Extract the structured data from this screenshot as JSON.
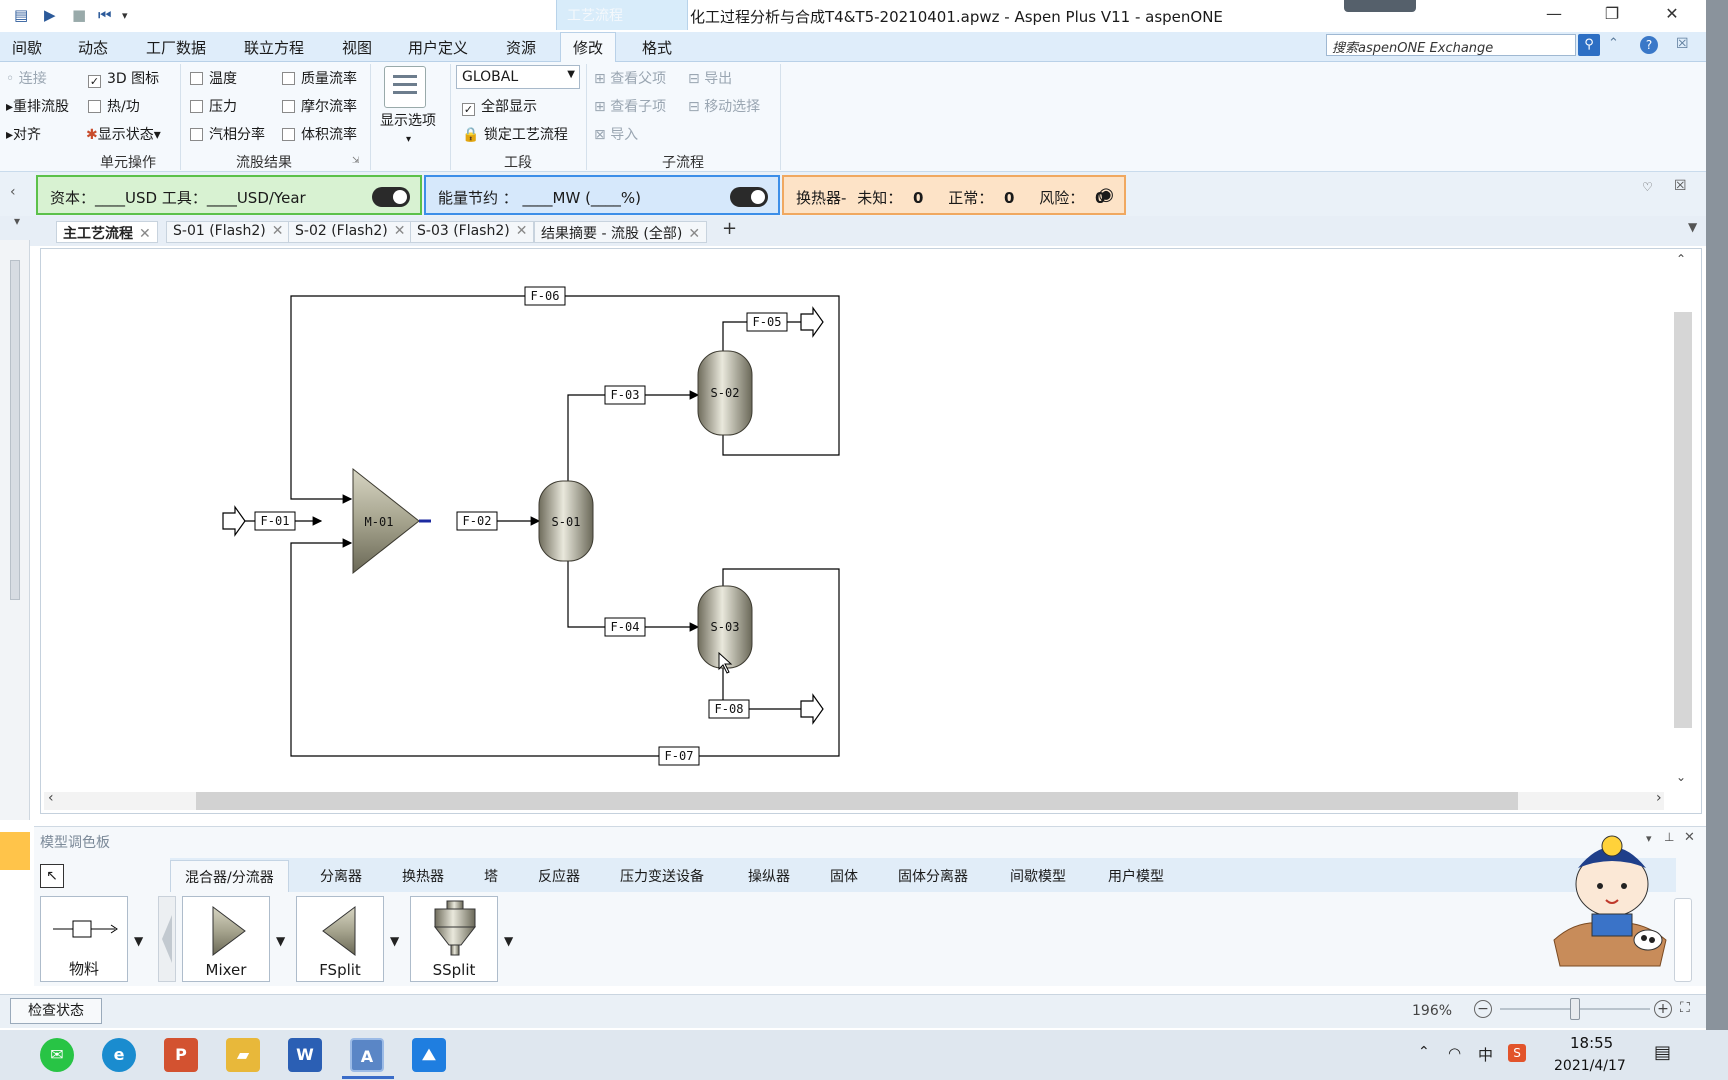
{
  "window": {
    "context_tab": "工艺流程",
    "title": "化工过程分析与合成T4&T5-20210401.apwz - Aspen Plus V11 - aspenONE",
    "minimize": "—",
    "restore": "❐",
    "close": "✕"
  },
  "ribbon": {
    "tabs": [
      "间歇",
      "动态",
      "工厂数据",
      "联立方程",
      "视图",
      "用户定义",
      "资源",
      "修改",
      "格式"
    ],
    "active_tab": "修改",
    "search_placeholder": "搜索aspenONE Exchange",
    "unit_ops": {
      "connect": "连接",
      "reroute": "重排流股",
      "align": "对齐",
      "icon_3d": "3D 图标",
      "heat_work": "热/功",
      "show_status": "显示状态",
      "group": "单元操作"
    },
    "stream_results": {
      "temperature": "温度",
      "pressure": "压力",
      "vapor_fraction": "汽相分率",
      "mass_flow": "质量流率",
      "mole_flow": "摩尔流率",
      "volume_flow": "体积流率",
      "group": "流股结果"
    },
    "display_options": "显示选项",
    "section": {
      "global": "GLOBAL",
      "show_all": "全部显示",
      "lock": "锁定工艺流程",
      "group": "工段"
    },
    "hierarchy": {
      "view_parent": "查看父项",
      "view_child": "查看子项",
      "import": "导入",
      "export": "导出",
      "move_selection": "移动选择",
      "group": "子流程"
    }
  },
  "activation": {
    "cost": "资本：____USD   工具：____USD/Year",
    "energy": "能量节约 ：  ____MW   (____%)",
    "hx_label": "换热器-",
    "unknown_label": "未知：",
    "unknown_value": "0",
    "normal_label": "正常：",
    "normal_value": "0",
    "risk_label": "风险：",
    "risk_value": "0"
  },
  "doc_tabs": [
    "主工艺流程",
    "S-01 (Flash2)",
    "S-02 (Flash2)",
    "S-03 (Flash2)",
    "结果摘要 - 流股 (全部)"
  ],
  "flowsheet": {
    "blocks": {
      "mixer": "M-01",
      "s01": "S-01",
      "s02": "S-02",
      "s03": "S-03"
    },
    "streams": {
      "f01": "F-01",
      "f02": "F-02",
      "f03": "F-03",
      "f04": "F-04",
      "f05": "F-05",
      "f06": "F-06",
      "f07": "F-07",
      "f08": "F-08"
    }
  },
  "palette": {
    "title": "模型调色板",
    "tabs": [
      "混合器/分流器",
      "分离器",
      "换热器",
      "塔",
      "反应器",
      "压力变送设备",
      "操纵器",
      "固体",
      "固体分离器",
      "间歇模型",
      "用户模型"
    ],
    "items": {
      "material": "物料",
      "mixer": "Mixer",
      "fsplit": "FSplit",
      "ssplit": "SSplit"
    }
  },
  "status": {
    "check": "检查状态",
    "zoom": "196%"
  },
  "taskbar": {
    "ime": "中",
    "time": "18:55",
    "date": "2021/4/17"
  }
}
